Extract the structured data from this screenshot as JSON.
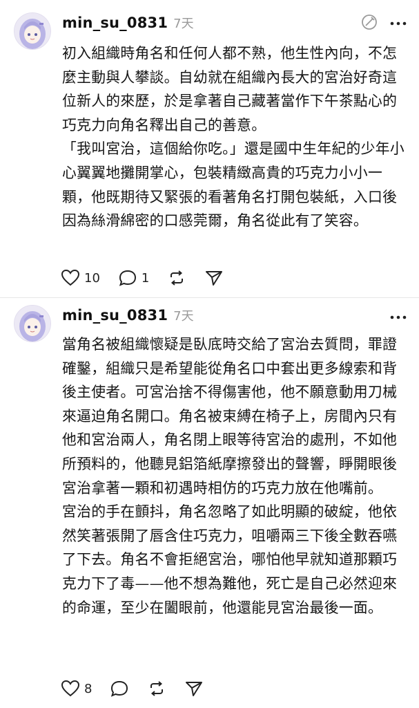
{
  "posts": [
    {
      "username": "min_su_0831",
      "time": "7天",
      "paragraphs": [
        "初入組織時角名和任何人都不熟，他生性內向，不怎麼主動與人攀談。自幼就在組織內長大的宮治好奇這位新人的來歷，於是拿著自己藏著當作下午茶點心的巧克力向角名釋出自己的善意。",
        "「我叫宮治，這個給你吃。」還是國中生年紀的少年小心翼翼地攤開掌心，包裝精緻高貴的巧克力小小一顆，他既期待又緊張的看著角名打開包裝紙，入口後因為絲滑綿密的口感莞爾，角名從此有了笑容。"
      ],
      "likes": "10",
      "replies": "1",
      "icons": [
        "heart-icon",
        "comment-icon",
        "repost-icon",
        "share-icon",
        "edit-icon",
        "more-icon"
      ]
    },
    {
      "username": "min_su_0831",
      "time": "7天",
      "paragraphs": [
        "當角名被組織懷疑是臥底時交給了宮治去質問，罪證確鑿，組織只是希望能從角名口中套出更多線索和背後主使者。可宮治捨不得傷害他，他不願意動用刀械來逼迫角名開口。角名被束縛在椅子上，房間內只有他和宮治兩人，角名閉上眼等待宮治的處刑，不如他所預料的，他聽見鋁箔紙摩擦發出的聲響，睜開眼後宮治拿著一顆和初遇時相仿的巧克力放在他嘴前。",
        "宮治的手在顫抖，角名忽略了如此明顯的破綻，他依然笑著張開了唇含住巧克力，咀嚼兩三下後全數吞嚥了下去。角名不會拒絕宮治，哪怕他早就知道那顆巧克力下了毒——他不想為難他，死亡是自己必然迎來的命運，至少在闔眼前，他還能見宮治最後一面。"
      ],
      "likes": "8",
      "icons": [
        "heart-icon",
        "comment-icon",
        "repost-icon",
        "share-icon",
        "more-icon"
      ]
    }
  ],
  "colors": {
    "text": "#151515",
    "muted": "#9a9a9a",
    "avatar_hair": "#b9b4e6",
    "divider": "#e6e6e6"
  }
}
